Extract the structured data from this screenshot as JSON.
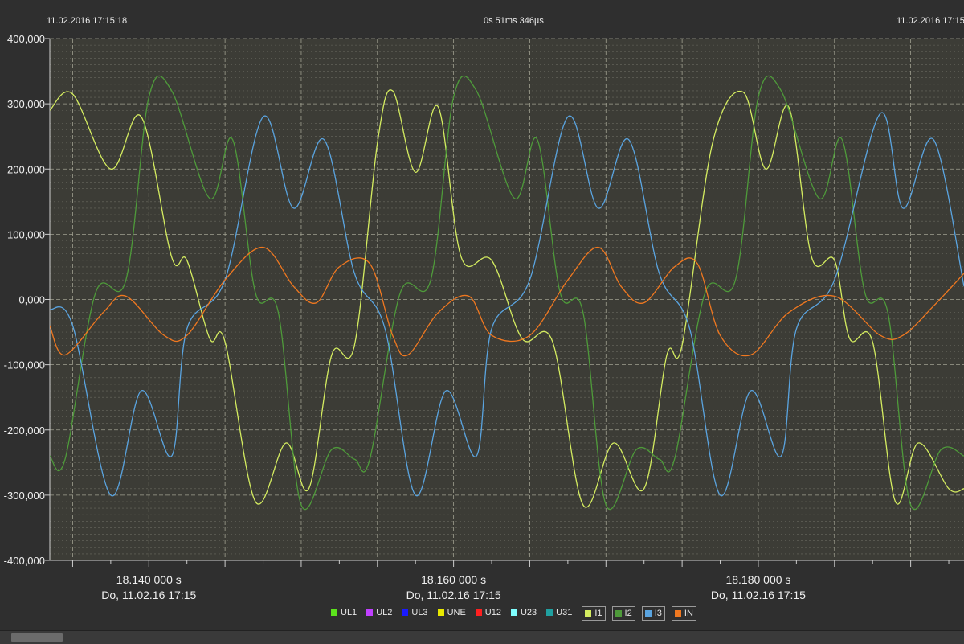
{
  "header": {
    "left_timestamp": "11.02.2016 17:15:18",
    "center_duration": "0s 51ms 346µs",
    "right_timestamp": "11.02.2016 17:15"
  },
  "colors": {
    "background": "#2f2f2f",
    "plot_background": "#3c3c36",
    "grid": "#7a7a6e",
    "UL1": "#5ce31c",
    "UL2": "#c040ff",
    "UL3": "#1a1aff",
    "UNE": "#e8e800",
    "U12": "#ff2020",
    "U23": "#80ffff",
    "U31": "#20a0a0",
    "I1": "#d4ec60",
    "I2": "#4e9a3a",
    "I3": "#5aa4e0",
    "IN": "#f07820"
  },
  "legend": [
    {
      "label": "UL1",
      "color": "#5ce31c",
      "boxed": false
    },
    {
      "label": "UL2",
      "color": "#c040ff",
      "boxed": false
    },
    {
      "label": "UL3",
      "color": "#1a1aff",
      "boxed": false
    },
    {
      "label": "UNE",
      "color": "#e8e800",
      "boxed": false
    },
    {
      "label": "U12",
      "color": "#ff2020",
      "boxed": false
    },
    {
      "label": "U23",
      "color": "#80ffff",
      "boxed": false
    },
    {
      "label": "U31",
      "color": "#20a0a0",
      "boxed": false
    },
    {
      "label": "I1",
      "color": "#d4ec60",
      "boxed": true
    },
    {
      "label": "I2",
      "color": "#4e9a3a",
      "boxed": true
    },
    {
      "label": "I3",
      "color": "#5aa4e0",
      "boxed": true
    },
    {
      "label": "IN",
      "color": "#f07820",
      "boxed": true
    }
  ],
  "chart_data": {
    "type": "line",
    "title": "",
    "xlabel": "",
    "ylabel": "",
    "xlim": [
      18.1335,
      18.1935
    ],
    "ylim": [
      -400,
      400
    ],
    "x_unit": "s",
    "y_tick_values": [
      400,
      300,
      200,
      100,
      0,
      -100,
      -200,
      -300,
      -400
    ],
    "y_tick_labels": [
      "400,000",
      "300,000",
      "200,000",
      "100,000",
      "0,000",
      "-100,000",
      "-200,000",
      "-300,000",
      "-400,000"
    ],
    "x_ticks": [
      {
        "value": 18.14,
        "label": "18.140 000 s",
        "date": "Do, 11.02.16 17:15"
      },
      {
        "value": 18.16,
        "label": "18.160 000 s",
        "date": "Do, 11.02.16 17:15"
      },
      {
        "value": 18.18,
        "label": "18.180 000 s",
        "date": "Do, 11.02.16 17:15"
      }
    ],
    "period_s": 0.02,
    "grid": true,
    "series": [
      {
        "name": "I1",
        "color": "#d4ec60",
        "x": [
          18.1335,
          18.135,
          18.1375,
          18.1395,
          18.1415,
          18.1425,
          18.144,
          18.145,
          18.147,
          18.149,
          18.1505,
          18.152,
          18.1535,
          18.155,
          18.156,
          18.1575,
          18.159,
          18.1605,
          18.1625,
          18.1645,
          18.1665,
          18.1685,
          18.1705,
          18.1725,
          18.174,
          18.175,
          18.177,
          18.179,
          18.1805,
          18.182,
          18.1835,
          18.185,
          18.186,
          18.1875,
          18.189,
          18.1905,
          18.1925,
          18.1935
        ],
        "y": [
          290,
          315,
          200,
          280,
          65,
          60,
          -60,
          -65,
          -310,
          -220,
          -290,
          -85,
          -70,
          240,
          320,
          195,
          295,
          65,
          60,
          -60,
          -65,
          -315,
          -220,
          -290,
          -85,
          -70,
          240,
          318,
          200,
          295,
          65,
          60,
          -60,
          -65,
          -310,
          -220,
          -290,
          -290
        ]
      },
      {
        "name": "I2",
        "color": "#4e9a3a",
        "x": [
          18.1335,
          18.1345,
          18.1365,
          18.1385,
          18.14,
          18.1415,
          18.144,
          18.1455,
          18.147,
          18.1485,
          18.15,
          18.152,
          18.1535,
          18.1545,
          18.1565,
          18.1585,
          18.16,
          18.1615,
          18.164,
          18.1655,
          18.167,
          18.1685,
          18.17,
          18.172,
          18.1735,
          18.1745,
          18.1765,
          18.1785,
          18.18,
          18.1815,
          18.184,
          18.1855,
          18.187,
          18.1885,
          18.19,
          18.192,
          18.1935
        ],
        "y": [
          -240,
          -245,
          10,
          30,
          310,
          320,
          155,
          245,
          10,
          -20,
          -315,
          -230,
          -245,
          -245,
          10,
          30,
          310,
          320,
          155,
          245,
          10,
          -20,
          -315,
          -230,
          -245,
          -245,
          10,
          30,
          310,
          320,
          155,
          245,
          10,
          -20,
          -315,
          -230,
          -240
        ]
      },
      {
        "name": "I3",
        "color": "#5aa4e0",
        "x": [
          18.1335,
          18.135,
          18.1375,
          18.1395,
          18.1415,
          18.1425,
          18.145,
          18.1475,
          18.1495,
          18.1515,
          18.1535,
          18.1555,
          18.1575,
          18.1595,
          18.1615,
          18.1625,
          18.165,
          18.1675,
          18.1695,
          18.1715,
          18.1735,
          18.1755,
          18.1775,
          18.1795,
          18.1815,
          18.1825,
          18.185,
          18.188,
          18.1895,
          18.1915,
          18.1935
        ],
        "y": [
          -15,
          -40,
          -300,
          -140,
          -240,
          -45,
          30,
          280,
          140,
          245,
          40,
          -45,
          -300,
          -140,
          -240,
          -45,
          30,
          280,
          140,
          245,
          40,
          -45,
          -300,
          -140,
          -240,
          -45,
          30,
          285,
          140,
          245,
          20
        ]
      },
      {
        "name": "IN",
        "color": "#f07820",
        "x": [
          18.1335,
          18.1345,
          18.137,
          18.1385,
          18.141,
          18.1425,
          18.145,
          18.1475,
          18.1495,
          18.151,
          18.1525,
          18.1545,
          18.156,
          18.157,
          18.159,
          18.161,
          18.1625,
          18.165,
          18.1675,
          18.1695,
          18.171,
          18.1725,
          18.1745,
          18.176,
          18.1775,
          18.1795,
          18.182,
          18.185,
          18.188,
          18.1895,
          18.1915,
          18.1935
        ],
        "y": [
          -40,
          -85,
          -20,
          5,
          -55,
          -55,
          30,
          80,
          20,
          -5,
          50,
          55,
          -55,
          -85,
          -20,
          5,
          -55,
          -55,
          30,
          80,
          20,
          -5,
          50,
          55,
          -55,
          -85,
          -20,
          5,
          -55,
          -55,
          -10,
          40
        ]
      }
    ]
  }
}
